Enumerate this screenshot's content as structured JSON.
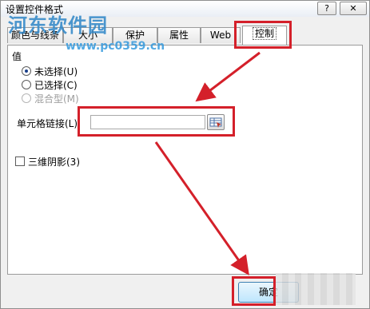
{
  "window": {
    "title": "设置控件格式",
    "help_label": "?",
    "close_label": "✕"
  },
  "tabs": [
    {
      "label": "颜色与线条"
    },
    {
      "label": "大小"
    },
    {
      "label": "保护"
    },
    {
      "label": "属性"
    },
    {
      "label": "Web"
    },
    {
      "label": "控制"
    }
  ],
  "value_group": {
    "label": "值",
    "options": [
      {
        "label": "未选择(U)",
        "checked": true,
        "enabled": true
      },
      {
        "label": "已选择(C)",
        "checked": false,
        "enabled": true
      },
      {
        "label": "混合型(M)",
        "checked": false,
        "enabled": false
      }
    ]
  },
  "cell_link": {
    "label": "单元格链接(L):",
    "value": ""
  },
  "shading": {
    "label": "三维阴影(3)",
    "checked": false
  },
  "buttons": {
    "ok_label": "确定"
  },
  "watermark": {
    "site_name": "河东软件园",
    "url": "www.pc0359.cn"
  },
  "colors": {
    "annotation_red": "#d4202a",
    "accent_blue": "#2e86c8"
  }
}
